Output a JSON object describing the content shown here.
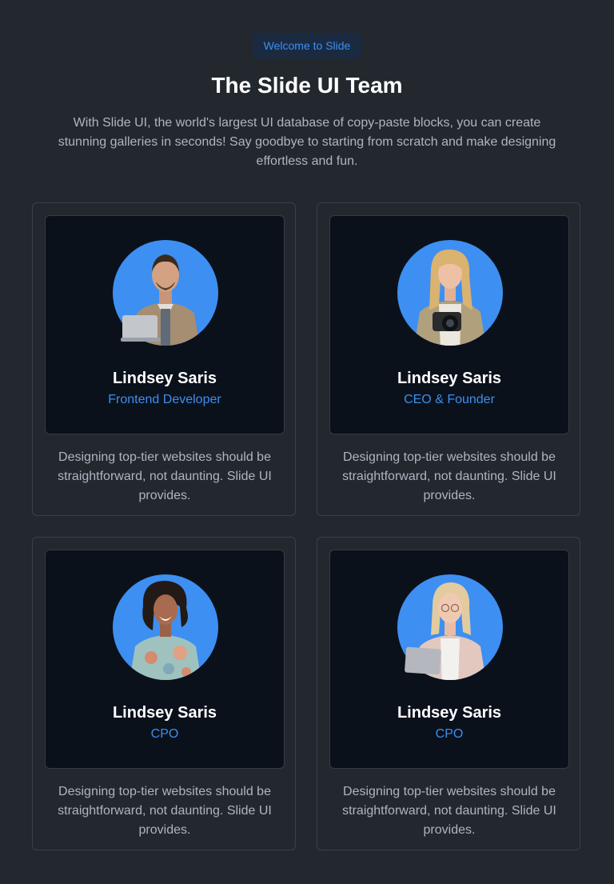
{
  "header": {
    "badge": "Welcome to Slide",
    "title": "The Slide UI Team",
    "intro": "With Slide UI, the world's largest UI database of copy-paste blocks, you can create stunning galleries in seconds! Say goodbye to starting from scratch and make designing effortless and fun."
  },
  "team": [
    {
      "name": "Lindsey Saris",
      "role": "Frontend Developer",
      "description": "Designing top-tier websites should be straightforward, not daunting. Slide UI provides.",
      "avatar_icon": "man-with-laptop-avatar"
    },
    {
      "name": "Lindsey Saris",
      "role": "CEO & Founder",
      "description": "Designing top-tier websites should be straightforward, not daunting. Slide UI provides.",
      "avatar_icon": "woman-with-camera-avatar"
    },
    {
      "name": "Lindsey Saris",
      "role": "CPO",
      "description": "Designing top-tier websites should be straightforward, not daunting. Slide UI provides.",
      "avatar_icon": "woman-curly-hair-avatar"
    },
    {
      "name": "Lindsey Saris",
      "role": "CPO",
      "description": "Designing top-tier websites should be straightforward, not daunting. Slide UI provides.",
      "avatar_icon": "woman-with-tablet-avatar"
    }
  ],
  "colors": {
    "background": "#23282f",
    "card_inner": "#0b111b",
    "accent": "#3b8ff0",
    "avatar_circle": "#3d8ff2"
  }
}
